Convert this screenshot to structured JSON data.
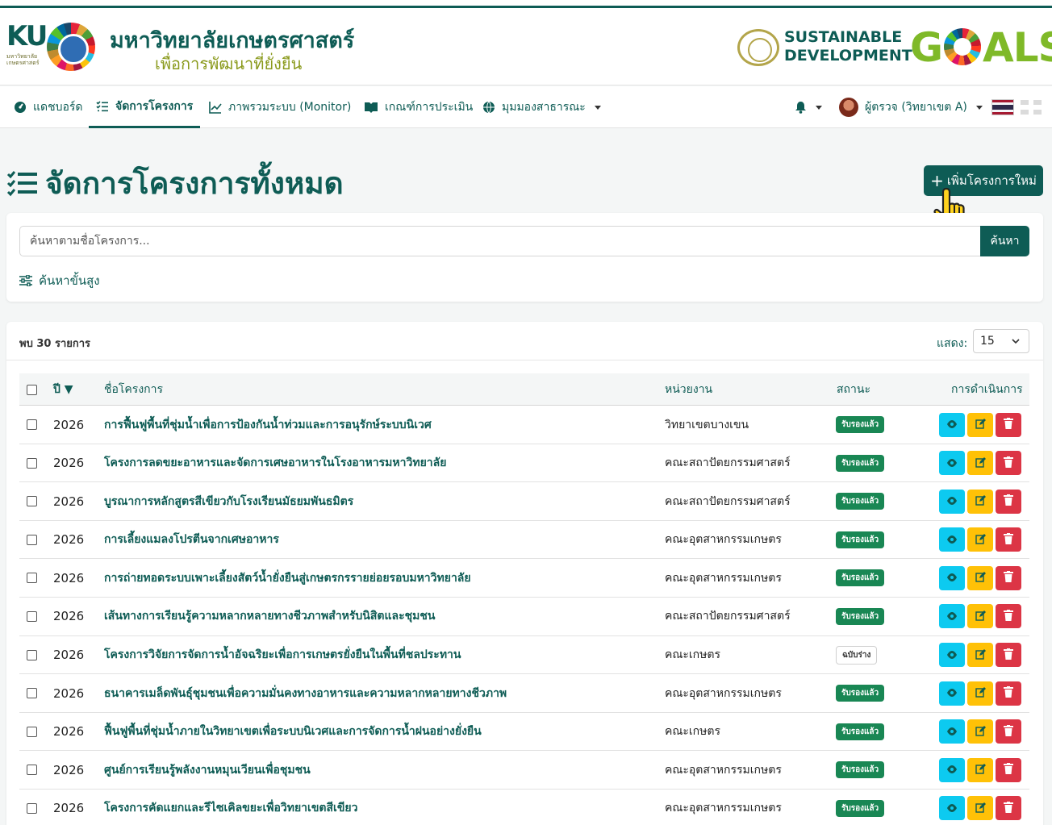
{
  "colors": {
    "primary": "#0e5c55",
    "approved": "#198754",
    "view": "#0dcaf0",
    "edit": "#ffc107",
    "delete": "#dc3545"
  },
  "header": {
    "ku_short": "KU",
    "ku_small": "มหาวิทยาลัยเกษตรศาสตร์",
    "university_name": "มหาวิทยาลัยเกษตรศาสตร์",
    "university_sub": "เพื่อการพัฒนาที่ยั่งยืน",
    "sdg_line1": "SUSTAINABLE",
    "sdg_line2": "DEVELOPMENT",
    "goals_g": "G",
    "goals_rest": "ALS"
  },
  "nav": {
    "dashboard": "แดชบอร์ด",
    "manage": "จัดการโครงการ",
    "monitor": "ภาพรวมระบบ (Monitor)",
    "criteria": "เกณฑ์การประเมิน",
    "public": "มุมมองสาธารณะ",
    "user": "ผู้ตรวจ (วิทยาเขต A)"
  },
  "page": {
    "title": "จัดการโครงการทั้งหมด",
    "add_button": "เพิ่มโครงการใหม่"
  },
  "search": {
    "placeholder": "ค้นหาตามชื่อโครงการ...",
    "button": "ค้นหา",
    "advanced": "ค้นหาขั้นสูง"
  },
  "table": {
    "found": "พบ 30 รายการ",
    "show_label": "แสดง:",
    "show_value": "15",
    "headers": {
      "year": "ปี ▼",
      "name": "ชื่อโครงการ",
      "unit": "หน่วยงาน",
      "status": "สถานะ",
      "actions": "การดำเนินการ"
    },
    "rows": [
      {
        "year": "2026",
        "name": "การฟื้นฟูพื้นที่ชุ่มน้ำเพื่อการป้องกันน้ำท่วมและการอนุรักษ์ระบบนิเวศ",
        "unit": "วิทยาเขตบางเขน",
        "status": "รับรองแล้ว",
        "status_type": "approved"
      },
      {
        "year": "2026",
        "name": "โครงการลดขยะอาหารและจัดการเศษอาหารในโรงอาหารมหาวิทยาลัย",
        "unit": "คณะสถาปัตยกรรมศาสตร์",
        "status": "รับรองแล้ว",
        "status_type": "approved"
      },
      {
        "year": "2026",
        "name": "บูรณาการหลักสูตรสีเขียวกับโรงเรียนมัธยมพันธมิตร",
        "unit": "คณะสถาปัตยกรรมศาสตร์",
        "status": "รับรองแล้ว",
        "status_type": "approved"
      },
      {
        "year": "2026",
        "name": "การเลี้ยงแมลงโปรตีนจากเศษอาหาร",
        "unit": "คณะอุตสาหกรรมเกษตร",
        "status": "รับรองแล้ว",
        "status_type": "approved"
      },
      {
        "year": "2026",
        "name": "การถ่ายทอดระบบเพาะเลี้ยงสัตว์น้ำยั่งยืนสู่เกษตรกรรายย่อยรอบมหาวิทยาลัย",
        "unit": "คณะอุตสาหกรรมเกษตร",
        "status": "รับรองแล้ว",
        "status_type": "approved"
      },
      {
        "year": "2026",
        "name": "เส้นทางการเรียนรู้ความหลากหลายทางชีวภาพสำหรับนิสิตและชุมชน",
        "unit": "คณะสถาปัตยกรรมศาสตร์",
        "status": "รับรองแล้ว",
        "status_type": "approved"
      },
      {
        "year": "2026",
        "name": "โครงการวิจัยการจัดการน้ำอัจฉริยะเพื่อการเกษตรยั่งยืนในพื้นที่ชลประทาน",
        "unit": "คณะเกษตร",
        "status": "ฉบับร่าง",
        "status_type": "draft"
      },
      {
        "year": "2026",
        "name": "ธนาคารเมล็ดพันธุ์ชุมชนเพื่อความมั่นคงทางอาหารและความหลากหลายทางชีวภาพ",
        "unit": "คณะอุตสาหกรรมเกษตร",
        "status": "รับรองแล้ว",
        "status_type": "approved"
      },
      {
        "year": "2026",
        "name": "ฟื้นฟูพื้นที่ชุ่มน้ำภายในวิทยาเขตเพื่อระบบนิเวศและการจัดการน้ำฝนอย่างยั่งยืน",
        "unit": "คณะเกษตร",
        "status": "รับรองแล้ว",
        "status_type": "approved"
      },
      {
        "year": "2026",
        "name": "ศูนย์การเรียนรู้พลังงานหมุนเวียนเพื่อชุมชน",
        "unit": "คณะอุตสาหกรรมเกษตร",
        "status": "รับรองแล้ว",
        "status_type": "approved"
      },
      {
        "year": "2026",
        "name": "โครงการคัดแยกและรีไซเคิลขยะเพื่อวิทยาเขตสีเขียว",
        "unit": "คณะอุตสาหกรรมเกษตร",
        "status": "รับรองแล้ว",
        "status_type": "approved"
      }
    ]
  }
}
